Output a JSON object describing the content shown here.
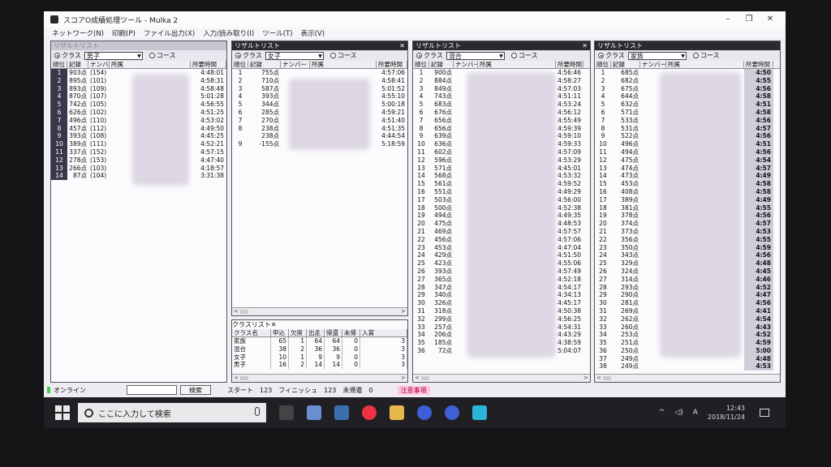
{
  "window": {
    "title": "スコアO成績処理ツール - Mulka 2"
  },
  "menu": [
    "ネットワーク(N)",
    "印刷(P)",
    "ファイル出力(X)",
    "入力/読み取り(I)",
    "ツール(T)",
    "表示(V)"
  ],
  "radio_labels": {
    "class": "クラス",
    "course": "コース"
  },
  "columns": {
    "rank": "順位",
    "record": "記録",
    "number": "ナンバー",
    "affil": "所属",
    "time": "所要時間"
  },
  "panels": [
    {
      "title": "リザルトリスト",
      "class_value": "男子",
      "rows": [
        {
          "rank": "1",
          "record": "903点",
          "number": "(154)",
          "affil": "",
          "time": "4:48:01"
        },
        {
          "rank": "2",
          "record": "895点",
          "number": "(101)",
          "affil": "",
          "time": "4:58:31"
        },
        {
          "rank": "3",
          "record": "893点",
          "number": "(109)",
          "affil": "",
          "time": "4:58:48"
        },
        {
          "rank": "4",
          "record": "870点",
          "number": "(107)",
          "affil": "",
          "time": "5:01:28"
        },
        {
          "rank": "5",
          "record": "742点",
          "number": "(105)",
          "affil": "",
          "time": "4:56:55"
        },
        {
          "rank": "6",
          "record": "626点",
          "number": "(102)",
          "affil": "",
          "time": "4:51:25"
        },
        {
          "rank": "7",
          "record": "496点",
          "number": "(110)",
          "affil": "",
          "time": "4:53:02"
        },
        {
          "rank": "8",
          "record": "457点",
          "number": "(112)",
          "affil": "",
          "time": "4:49:50"
        },
        {
          "rank": "9",
          "record": "393点",
          "number": "(108)",
          "affil": "",
          "time": "4:45:25"
        },
        {
          "rank": "10",
          "record": "389点",
          "number": "(111)",
          "affil": "",
          "time": "4:52:21"
        },
        {
          "rank": "11",
          "record": "337点",
          "number": "(152)",
          "affil": "",
          "time": "4:57:15"
        },
        {
          "rank": "12",
          "record": "278点",
          "number": "(153)",
          "affil": "",
          "time": "4:47:40"
        },
        {
          "rank": "13",
          "record": "266点",
          "number": "(103)",
          "affil": "",
          "time": "4:18:57"
        },
        {
          "rank": "14",
          "record": "87点",
          "number": "(104)",
          "affil": "",
          "time": "3:31:38"
        }
      ]
    },
    {
      "title": "リザルトリスト",
      "class_value": "女子",
      "rows": [
        {
          "rank": "1",
          "record": "755点",
          "time": "4:57:06"
        },
        {
          "rank": "2",
          "record": "710点",
          "time": "4:58:41"
        },
        {
          "rank": "3",
          "record": "587点",
          "time": "5:01:52"
        },
        {
          "rank": "4",
          "record": "393点",
          "time": "4:55:10"
        },
        {
          "rank": "5",
          "record": "344点",
          "time": "5:00:18"
        },
        {
          "rank": "6",
          "record": "285点",
          "time": "4:59:21"
        },
        {
          "rank": "7",
          "record": "270点",
          "time": "4:51:40"
        },
        {
          "rank": "8",
          "record": "238点",
          "time": "4:51:35"
        },
        {
          "rank": "",
          "record": "238点",
          "time": "4:44:54"
        },
        {
          "rank": "9",
          "record": "-155点",
          "time": "5:18:59"
        }
      ]
    },
    {
      "title": "リザルトリスト",
      "class_value": "混合",
      "rows": [
        {
          "rank": "1",
          "record": "900点",
          "time": "4:56:46"
        },
        {
          "rank": "2",
          "record": "884点",
          "time": "4:58:27"
        },
        {
          "rank": "3",
          "record": "849点",
          "time": "4:57:03"
        },
        {
          "rank": "4",
          "record": "743点",
          "time": "4:51:11"
        },
        {
          "rank": "5",
          "record": "683点",
          "time": "4:53:24"
        },
        {
          "rank": "6",
          "record": "676点",
          "time": "4:56:12"
        },
        {
          "rank": "7",
          "record": "656点",
          "time": "4:55:49"
        },
        {
          "rank": "8",
          "record": "656点",
          "time": "4:59:39"
        },
        {
          "rank": "9",
          "record": "639点",
          "time": "4:59:10"
        },
        {
          "rank": "10",
          "record": "636点",
          "time": "4:59:33"
        },
        {
          "rank": "11",
          "record": "602点",
          "time": "4:57:09"
        },
        {
          "rank": "12",
          "record": "596点",
          "time": "4:53:29"
        },
        {
          "rank": "13",
          "record": "571点",
          "time": "4:45:01"
        },
        {
          "rank": "14",
          "record": "568点",
          "time": "4:53:32"
        },
        {
          "rank": "15",
          "record": "561点",
          "time": "4:59:52"
        },
        {
          "rank": "16",
          "record": "551点",
          "time": "4:49:29"
        },
        {
          "rank": "17",
          "record": "503点",
          "time": "4:56:00"
        },
        {
          "rank": "18",
          "record": "500点",
          "time": "4:52:38"
        },
        {
          "rank": "19",
          "record": "494点",
          "time": "4:49:35"
        },
        {
          "rank": "20",
          "record": "475点",
          "time": "4:48:53"
        },
        {
          "rank": "21",
          "record": "469点",
          "time": "4:57:57"
        },
        {
          "rank": "22",
          "record": "456点",
          "time": "4:57:06"
        },
        {
          "rank": "23",
          "record": "453点",
          "time": "4:47:04"
        },
        {
          "rank": "24",
          "record": "429点",
          "time": "4:51:50"
        },
        {
          "rank": "25",
          "record": "423点",
          "time": "4:55:06"
        },
        {
          "rank": "26",
          "record": "393点",
          "time": "4:57:49"
        },
        {
          "rank": "27",
          "record": "365点",
          "time": "4:52:18"
        },
        {
          "rank": "28",
          "record": "347点",
          "time": "4:54:17"
        },
        {
          "rank": "29",
          "record": "340点",
          "time": "4:34:13"
        },
        {
          "rank": "30",
          "record": "326点",
          "time": "4:45:17"
        },
        {
          "rank": "31",
          "record": "318点",
          "time": "4:50:38"
        },
        {
          "rank": "32",
          "record": "299点",
          "time": "4:56:25"
        },
        {
          "rank": "33",
          "record": "257点",
          "time": "4:54:31"
        },
        {
          "rank": "34",
          "record": "206点",
          "time": "4:43:29"
        },
        {
          "rank": "35",
          "record": "185点",
          "time": "4:38:59"
        },
        {
          "rank": "36",
          "record": "72点",
          "time": "5:04:07"
        }
      ]
    },
    {
      "title": "リザルトリスト",
      "class_value": "家族",
      "rows": [
        {
          "rank": "1",
          "record": "685点",
          "time": "4:50"
        },
        {
          "rank": "2",
          "record": "682点",
          "time": "4:55"
        },
        {
          "rank": "3",
          "record": "675点",
          "time": "4:56"
        },
        {
          "rank": "4",
          "record": "644点",
          "time": "4:58"
        },
        {
          "rank": "5",
          "record": "632点",
          "time": "4:51"
        },
        {
          "rank": "6",
          "record": "571点",
          "time": "4:58"
        },
        {
          "rank": "7",
          "record": "533点",
          "time": "4:56"
        },
        {
          "rank": "8",
          "record": "531点",
          "time": "4:57"
        },
        {
          "rank": "9",
          "record": "522点",
          "time": "4:56"
        },
        {
          "rank": "10",
          "record": "496点",
          "time": "4:51"
        },
        {
          "rank": "11",
          "record": "494点",
          "time": "4:56"
        },
        {
          "rank": "12",
          "record": "475点",
          "time": "4:54"
        },
        {
          "rank": "13",
          "record": "474点",
          "time": "4:57"
        },
        {
          "rank": "14",
          "record": "473点",
          "time": "4:49"
        },
        {
          "rank": "15",
          "record": "453点",
          "time": "4:58"
        },
        {
          "rank": "16",
          "record": "408点",
          "time": "4:58"
        },
        {
          "rank": "17",
          "record": "389点",
          "time": "4:49"
        },
        {
          "rank": "18",
          "record": "381点",
          "time": "4:55"
        },
        {
          "rank": "19",
          "record": "378点",
          "time": "4:56"
        },
        {
          "rank": "20",
          "record": "374点",
          "time": "4:57"
        },
        {
          "rank": "21",
          "record": "373点",
          "time": "4:53"
        },
        {
          "rank": "22",
          "record": "356点",
          "time": "4:55"
        },
        {
          "rank": "23",
          "record": "350点",
          "time": "4:59"
        },
        {
          "rank": "24",
          "record": "343点",
          "time": "4:56"
        },
        {
          "rank": "25",
          "record": "329点",
          "time": "4:48"
        },
        {
          "rank": "26",
          "record": "324点",
          "time": "4:45"
        },
        {
          "rank": "27",
          "record": "314点",
          "time": "4:46"
        },
        {
          "rank": "28",
          "record": "293点",
          "time": "4:52"
        },
        {
          "rank": "29",
          "record": "290点",
          "time": "4:47"
        },
        {
          "rank": "30",
          "record": "281点",
          "time": "4:56"
        },
        {
          "rank": "31",
          "record": "269点",
          "time": "4:41"
        },
        {
          "rank": "32",
          "record": "262点",
          "time": "4:54"
        },
        {
          "rank": "33",
          "record": "260点",
          "time": "4:43"
        },
        {
          "rank": "34",
          "record": "253点",
          "time": "4:52"
        },
        {
          "rank": "35",
          "record": "251点",
          "time": "4:59"
        },
        {
          "rank": "36",
          "record": "250点",
          "time": "5:00"
        },
        {
          "rank": "37",
          "record": "249点",
          "time": "4:48"
        },
        {
          "rank": "38",
          "record": "249点",
          "time": "4:53"
        }
      ]
    }
  ],
  "class_list": {
    "title": "クラスリスト",
    "headers": [
      "クラス名",
      "申込",
      "欠席",
      "出走",
      "帰還",
      "未帰",
      "入賞"
    ],
    "rows": [
      [
        "家族",
        "65",
        "1",
        "64",
        "64",
        "0",
        "3"
      ],
      [
        "混合",
        "38",
        "2",
        "36",
        "36",
        "0",
        "3"
      ],
      [
        "女子",
        "10",
        "1",
        "9",
        "9",
        "0",
        "3"
      ],
      [
        "男子",
        "16",
        "2",
        "14",
        "14",
        "0",
        "3"
      ]
    ]
  },
  "status": {
    "online": "オンライン",
    "search_button": "検索",
    "start_label": "スタート",
    "start_value": "123",
    "finish_label": "フィニッシュ",
    "finish_value": "123",
    "unreturned_label": "未帰還",
    "unreturned_value": "0",
    "warning": "注意事項"
  },
  "taskbar": {
    "search_placeholder": "ここに入力して検索",
    "time": "12:43",
    "date": "2018/11/24",
    "ime": "A"
  },
  "colors": {
    "title_dark": "#2a2a2f",
    "warning_bg": "#ffc7df",
    "warning_fg": "#b0004a"
  }
}
